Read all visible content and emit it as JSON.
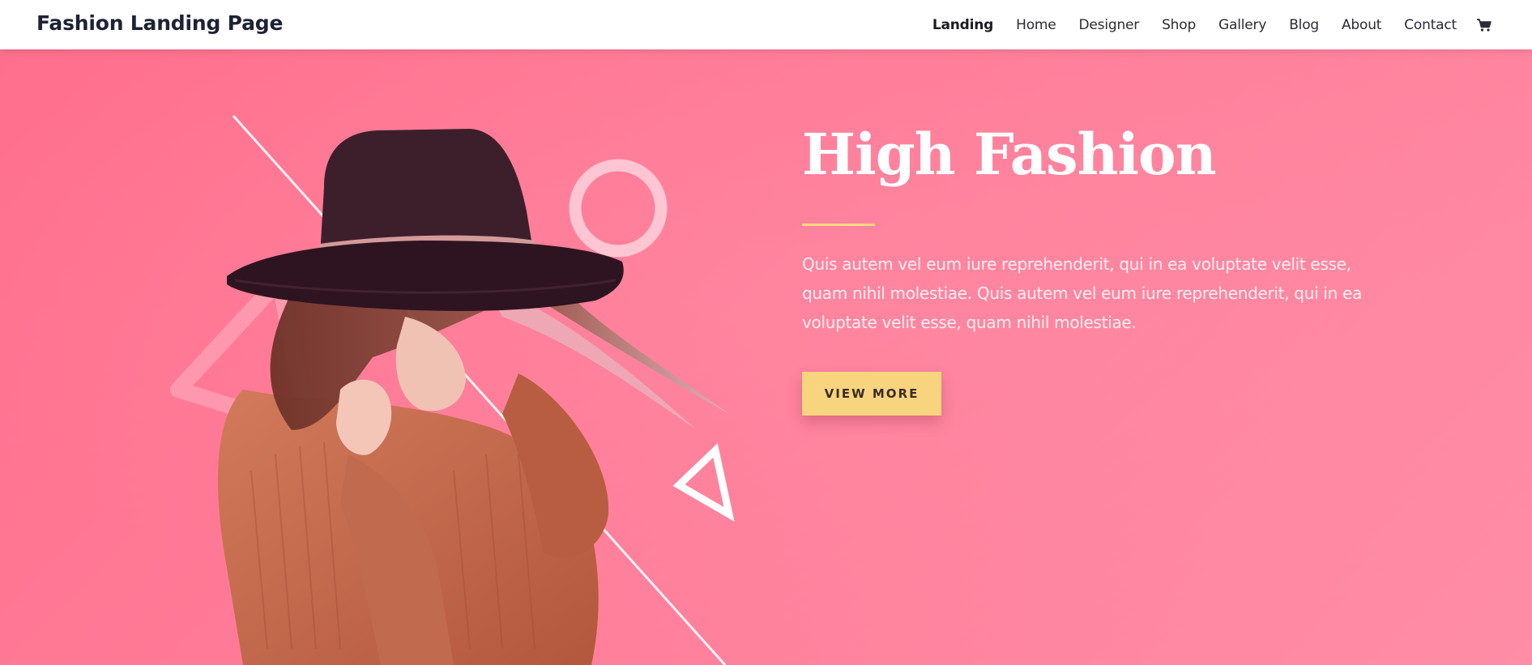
{
  "site": {
    "title": "Fashion Landing Page"
  },
  "nav": {
    "items": [
      {
        "label": "Landing",
        "active": true
      },
      {
        "label": "Home"
      },
      {
        "label": "Designer"
      },
      {
        "label": "Shop"
      },
      {
        "label": "Gallery"
      },
      {
        "label": "Blog"
      },
      {
        "label": "About"
      },
      {
        "label": "Contact"
      }
    ],
    "cart_icon": "shopping-cart-icon"
  },
  "hero": {
    "title": "High Fashion",
    "description": "Quis autem vel eum iure reprehenderit, qui in ea voluptate velit esse, quam nihil molestiae. Quis autem vel eum iure reprehenderit, qui in ea voluptate velit esse, quam nihil molestiae.",
    "cta_label": "VIEW MORE"
  },
  "colors": {
    "hero_background": "#ff7a95",
    "accent": "#f9d47e",
    "header_background": "#ffffff",
    "text_dark": "#1f2235"
  }
}
